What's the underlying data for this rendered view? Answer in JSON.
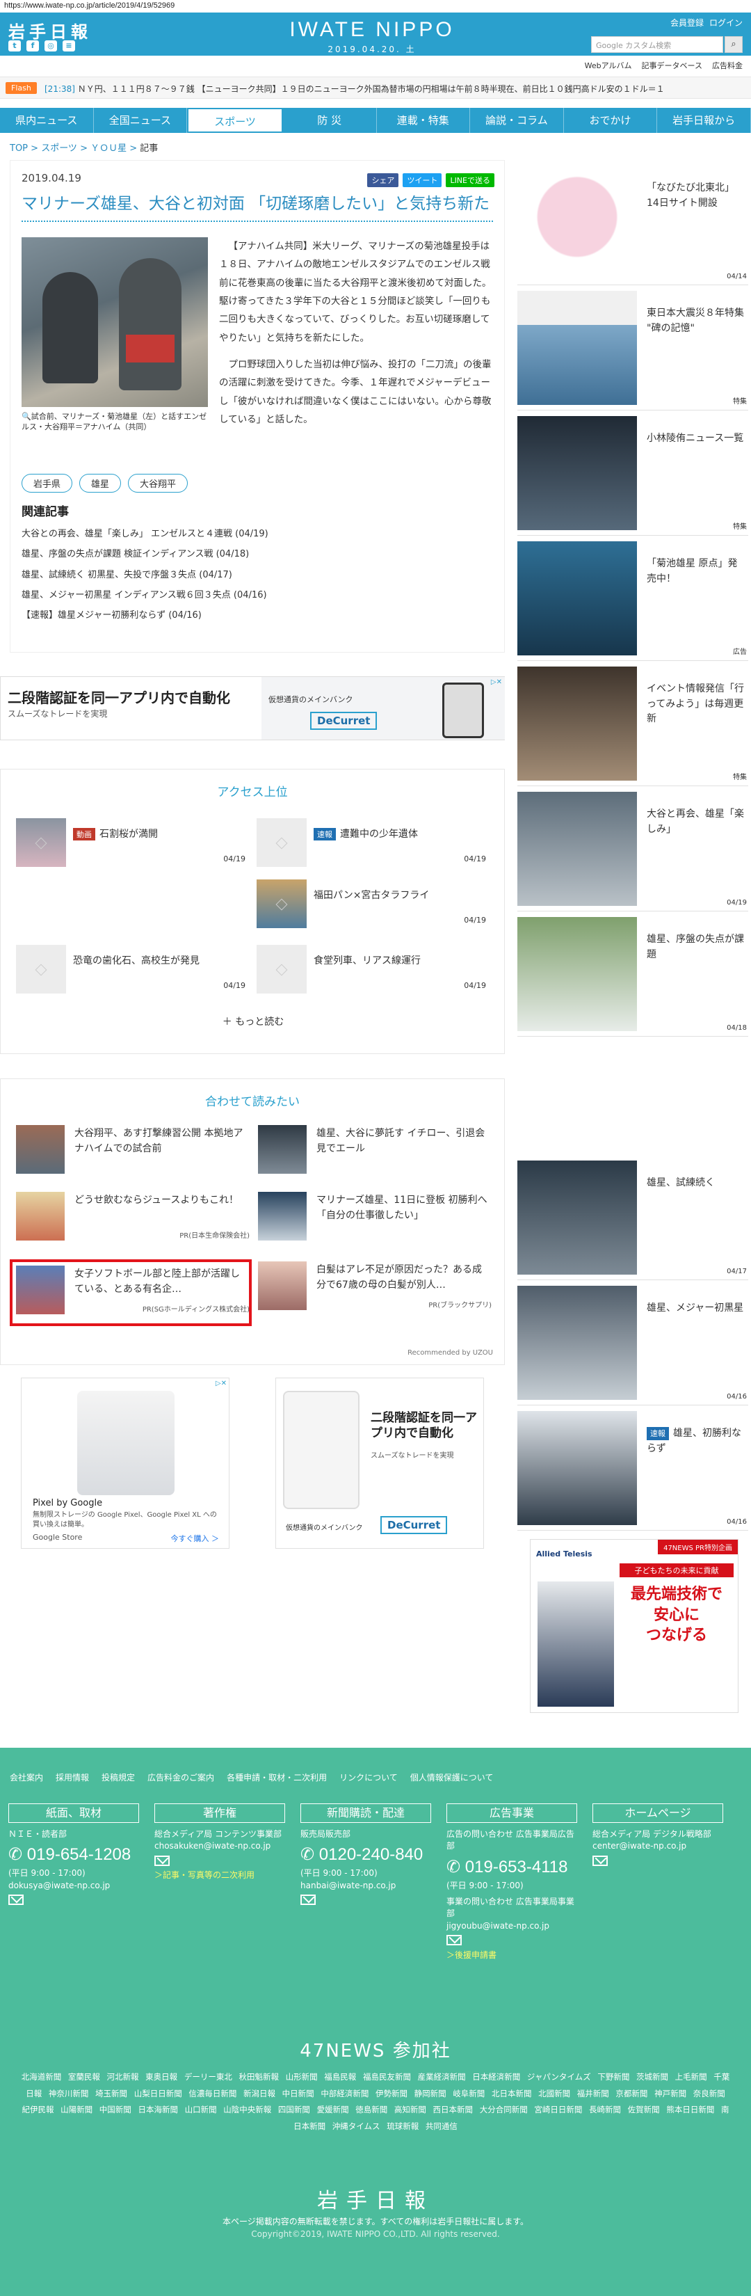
{
  "url": "https://www.iwate-np.co.jp/article/2019/4/19/52969",
  "header": {
    "logo": "岩手日報",
    "brand": "IWATE NIPPO",
    "date": "2019.04.20. 土",
    "links": [
      "会員登録",
      "ログイン"
    ],
    "search_placeholder": "Google カスタム検索",
    "sublinks": [
      "Webアルバム",
      "記事データベース",
      "広告料金"
    ]
  },
  "flash": {
    "tag": "Flash",
    "text_time": "[21:38]",
    "text": "ＮＹ円、１１１円８７～９７銭 【ニューヨーク共同】１９日のニューヨーク外国為替市場の円相場は午前８時半現在、前日比１０銭円高ドル安の１ドル＝１"
  },
  "nav": [
    "県内ニュース",
    "全国ニュース",
    "スポーツ",
    "防 災",
    "連載・特集",
    "論説・コラム",
    "おでかけ",
    "岩手日報から"
  ],
  "breadcrumb": [
    "TOP",
    "スポーツ",
    "ＹＯＵ星",
    "記事"
  ],
  "article": {
    "date": "2019.04.19",
    "share": [
      "シェア",
      "ツイート",
      "LINEで送る"
    ],
    "title": "マリナーズ雄星、大谷と初対面 「切磋琢磨したい」と気持ち新た",
    "caption": "試合前、マリナーズ・菊池雄星（左）と話すエンゼルス・大谷翔平＝アナハイム（共同）",
    "body1": "【アナハイム共同】米大リーグ、マリナーズの菊池雄星投手は１８日、アナハイムの敵地エンゼルスタジアムでのエンゼルス戦前に花巻東高の後輩に当たる大谷翔平と渡米後初めて対面した。駆け寄ってきた３学年下の大谷と１５分間ほど談笑し「一回りも二回りも大きくなっていて、びっくりした。お互い切磋琢磨してやりたい」と気持ちを新たにした。",
    "body2": "プロ野球団入りした当初は伸び悩み、投打の「二刀流」の後輩の活躍に刺激を受けてきた。今季、１年遅れでメジャーデビューし「彼がいなければ間違いなく僕はここにはいない。心から尊敬している」と話した。",
    "tags": [
      "岩手県",
      "雄星",
      "大谷翔平"
    ],
    "related_heading": "関連記事",
    "related": [
      "大谷との再会、雄星「楽しみ」 エンゼルスと４連戦 (04/19)",
      "雄星、序盤の失点が課題 検証インディアンス戦 (04/18)",
      "雄星、試練続く 初黒星、失投で序盤３失点 (04/17)",
      "雄星、メジャー初黒星 インディアンス戦６回３失点 (04/16)",
      "【速報】雄星メジャー初勝利ならず (04/16)"
    ]
  },
  "ad1": {
    "title": "二段階認証を同一アプリ内で自動化",
    "sub": "スムーズなトレードを実現",
    "right_text": "仮想通貨のメインバンク",
    "logo": "DeCurret"
  },
  "access": {
    "heading": "アクセス上位",
    "items": [
      {
        "badge": "動画",
        "badge_color": "#c0392b",
        "title": "石割桜が満開",
        "date": "04/19"
      },
      {
        "badge": "速報",
        "badge_color": "#1f6fb2",
        "title": "遭難中の少年遺体",
        "date": "04/19"
      },
      {
        "badge": "",
        "badge_color": "",
        "title": "福田パン×宮古タラフライ",
        "date": "04/19"
      },
      {
        "badge": "",
        "badge_color": "",
        "title": "恐竜の歯化石、高校生が発見",
        "date": "04/19"
      },
      {
        "badge": "",
        "badge_color": "",
        "title": "食堂列車、リアス線運行",
        "date": "04/19"
      }
    ],
    "more": "もっと読む"
  },
  "recommend": {
    "heading": "合わせて読みたい",
    "items": [
      {
        "title": "大谷翔平、あす打撃練習公開 本拠地アナハイムでの試合前",
        "pr": ""
      },
      {
        "title": "雄星、大谷に夢託す イチロー、引退会見でエール",
        "pr": ""
      },
      {
        "title": "どうせ飲むならジュースよりもこれ！",
        "pr": "PR(日本生命保険会社)"
      },
      {
        "title": "マリナーズ雄星、11日に登板 初勝利へ「自分の仕事徹したい」",
        "pr": ""
      },
      {
        "title": "女子ソフトボール部と陸上部が活躍している、とある有名企…",
        "pr": "PR(SGホールディングス株式会社)"
      },
      {
        "title": "白髪はアレ不足が原因だった？ある成分で67歳の母の白髪が別人…",
        "pr": "PR(ブラックサプリ)"
      }
    ],
    "credit": "Recommended by UZOU"
  },
  "ad2": {
    "left_title": "Pixel by Google",
    "left_text": "無制限ストレージの Google Pixel、Google Pixel XL への買い換えは簡単。",
    "left_store": "Google Store",
    "left_cta": "今すぐ購入 ＞",
    "right_title": "二段階認証を同一アプリ内で自動化",
    "right_sub": "スムーズなトレードを実現",
    "right_text": "仮想通貨のメインバンク",
    "right_logo": "DeCurret"
  },
  "sidebar": [
    {
      "title": "「なびたび北東北」14日サイト開設",
      "foot": "04/14",
      "color": "#f2c7d6"
    },
    {
      "title": "東日本大震災８年特集 \"碑の記憶\"",
      "foot": "特集",
      "color": "#4f88b8"
    },
    {
      "title": "小林陵侑ニュース一覧",
      "foot": "特集",
      "color": "#2d3b4b"
    },
    {
      "title": "「菊池雄星 原点」発売中！",
      "foot": "広告",
      "color": "#3a7fa6"
    },
    {
      "title": "イベント情報発信「行ってみよう」は毎週更新",
      "foot": "特集",
      "color": "#7b6b5c"
    },
    {
      "title": "大谷と再会、雄星「楽しみ」",
      "foot": "04/19",
      "color": "#7a8b99"
    },
    {
      "title": "雄星、序盤の失点が課題",
      "foot": "04/18",
      "color": "#6f8f6b"
    },
    {
      "title": "雄星、試練続く",
      "foot": "04/17",
      "color": "#4d5c6a"
    },
    {
      "title": "雄星、メジャー初黒星",
      "foot": "04/16",
      "color": "#5e6b78"
    },
    {
      "title": "雄星、初勝利ならず",
      "badge": "速報",
      "foot": "04/16",
      "color": "#cfd6de"
    }
  ],
  "side_ad": {
    "tag": "47NEWS PR特別企画",
    "brand": "Allied Telesis",
    "l1": "子どもたちの未来に貢献",
    "l2": "最先端技術で",
    "l3": "安心に",
    "l4": "つなげる"
  },
  "footer": {
    "links": [
      "会社案内",
      "採用情報",
      "投稿規定",
      "広告料金のご案内",
      "各種申請・取材・二次利用",
      "リンクについて",
      "個人情報保護について"
    ],
    "cols": [
      {
        "head": "紙面、取材",
        "l1": "ＮＩＥ・読者部",
        "tel": "019-654-1208",
        "hours": "(平日 9:00 - 17:00)",
        "mail": "dokusya@iwate-np.co.jp",
        "extra": ""
      },
      {
        "head": "著作権",
        "l1": "総合メディア局 コンテンツ事業部",
        "tel": "",
        "hours": "",
        "mail": "chosakuken@iwate-np.co.jp",
        "extra": "＞記事・写真等の二次利用"
      },
      {
        "head": "新聞購読・配達",
        "l1": "販売局販売部",
        "tel": "0120-240-840",
        "hours": "(平日 9:00 - 17:00)",
        "mail": "hanbai@iwate-np.co.jp",
        "extra": ""
      },
      {
        "head": "広告事業",
        "l1": "広告の問い合わせ 広告事業局広告部",
        "tel": "019-653-4118",
        "hours": "(平日 9:00 - 17:00)",
        "mail": "jigyoubu@iwate-np.co.jp",
        "extra": "＞後援申請書"
      },
      {
        "head": "ホームページ",
        "l1": "総合メディア局 デジタル戦略部",
        "tel": "",
        "hours": "",
        "mail": "center@iwate-np.co.jp",
        "extra": ""
      }
    ],
    "ad_contact": "事業の問い合わせ 広告事業局事業部",
    "heading47": "47NEWS 参加社",
    "news47": "北海道新聞 室蘭民報 河北新報 東奥日報 デーリー東北 秋田魁新報 山形新聞 福島民報 福島民友新聞 産業経済新聞 日本経済新聞 ジャパンタイムズ 下野新聞 茨城新聞 上毛新聞 千葉日報 神奈川新聞 埼玉新聞 山梨日日新聞 信濃毎日新聞 新潟日報 中日新聞 中部経済新聞 伊勢新聞 静岡新聞 岐阜新聞 北日本新聞 北國新聞 福井新聞 京都新聞 神戸新聞 奈良新聞 紀伊民報 山陽新聞 中国新聞 日本海新聞 山口新聞 山陰中央新報 四国新聞 愛媛新聞 徳島新聞 高知新聞 西日本新聞 大分合同新聞 宮崎日日新聞 長崎新聞 佐賀新聞 熊本日日新聞 南日本新聞 沖縄タイムス 琉球新報 共同通信",
    "logo": "岩手日報",
    "note": "本ページ掲載内容の無断転載を禁じます。すべての権利は岩手日報社に属します。",
    "copyright": "Copyright©2019, IWATE NIPPO CO.,LTD. All rights reserved."
  }
}
